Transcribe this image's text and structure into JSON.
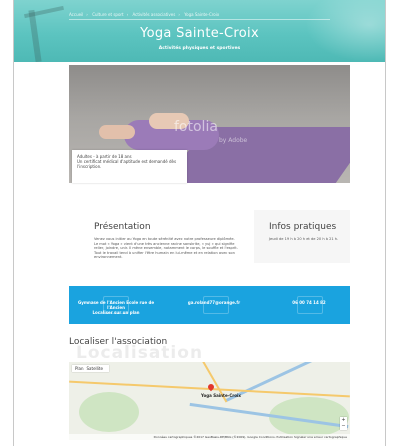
{
  "breadcrumb": [
    "Accueil",
    "Culture et sport",
    "Activités associatives",
    "Yoga Sainte-Croix"
  ],
  "hero": {
    "title": "Yoga Sainte-Croix",
    "subtitle": "Activités physiques et sportives"
  },
  "photo": {
    "watermark": "fotolia",
    "watermark_sub": "by Adobe"
  },
  "infobox": {
    "line1": "Adultes - à partir de 18 ans",
    "line2": "Un certificat médical d'aptitude est demandé dès l'inscription."
  },
  "presentation": {
    "title": "Présentation",
    "text": "Venez vous initier au Yoga en toute sérénité avec notre professeure diplômée. Le mot « Yoga » vient d'une très ancienne racine sanskrite, « yuj » qui signifie relier, joindre, unir. Il mène ensemble, notamment le corps, le souffle et l'esprit. Tout le travail tend à unifier l'être humain en lui-même et en relation avec son environnement."
  },
  "pratiques": {
    "title": "Infos pratiques",
    "text": "Jeudi de 19 h à 20 h et de 20 h à 21 h."
  },
  "contact": {
    "address_line1": "Gymnase de l'Ancien Ecole rue de l'Ancien",
    "address_line2": "Localiser sur un plan",
    "email": "ga.roland77@orange.fr",
    "phone": "06 00 74 14 82"
  },
  "localisation": {
    "title": "Localiser l'association",
    "ghost": "Localisation"
  },
  "map": {
    "tab_plan": "Plan",
    "tab_satellite": "Satellite",
    "place_label": "Yoga Sainte-Croix",
    "zoom_in": "+",
    "zoom_out": "−",
    "footer": "Données cartographiques ©2017 GeoBasis-DE/BKG (©2009), Google  Conditions d'utilisation  Signaler une erreur cartographique"
  }
}
